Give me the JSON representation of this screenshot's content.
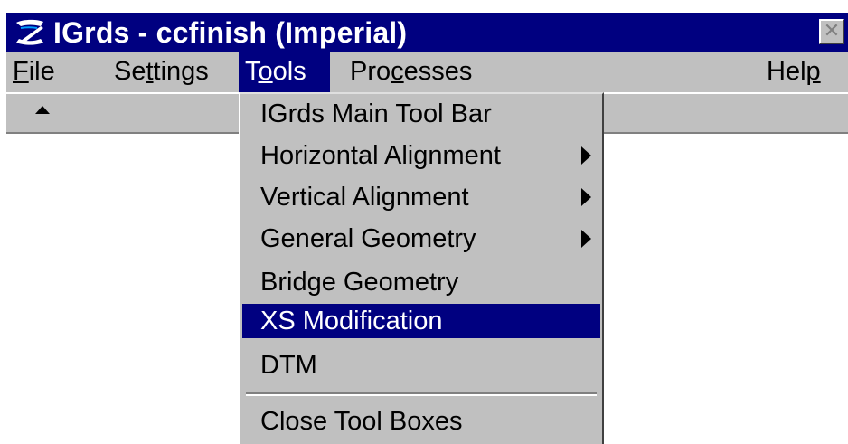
{
  "window": {
    "title": "IGrds - ccfinish (Imperial)",
    "logo_icon": "igrds-logo-icon",
    "close_icon": "close-icon",
    "close_glyph": "✕"
  },
  "menubar": {
    "items": [
      {
        "pre": "",
        "key": "F",
        "post": "ile"
      },
      {
        "pre": "Se",
        "key": "t",
        "post": "tings"
      },
      {
        "pre": "T",
        "key": "o",
        "post": "ols"
      },
      {
        "pre": "Pro",
        "key": "c",
        "post": "esses"
      },
      {
        "pre": "Hel",
        "key": "p",
        "post": ""
      }
    ],
    "active_index": 2
  },
  "toolstrip": {
    "collapse_icon": "triangle-up-icon"
  },
  "tools_menu": {
    "items": [
      {
        "label": "IGrds Main Tool Bar",
        "submenu": false
      },
      {
        "label": "Horizontal Alignment",
        "submenu": true
      },
      {
        "label": "Vertical Alignment",
        "submenu": true
      },
      {
        "label": "General Geometry",
        "submenu": true
      },
      {
        "label": "Bridge Geometry",
        "submenu": false
      },
      {
        "label": "XS Modification",
        "submenu": false,
        "highlighted": true
      },
      {
        "label": "DTM",
        "submenu": false
      },
      {
        "label": "Close Tool Boxes",
        "submenu": false
      }
    ],
    "submenu_icon": "triangle-right-icon"
  },
  "colors": {
    "titlebar": "#000080",
    "menu_face": "#c0c0c0",
    "highlight": "#000080",
    "highlight_text": "#ffffff"
  }
}
